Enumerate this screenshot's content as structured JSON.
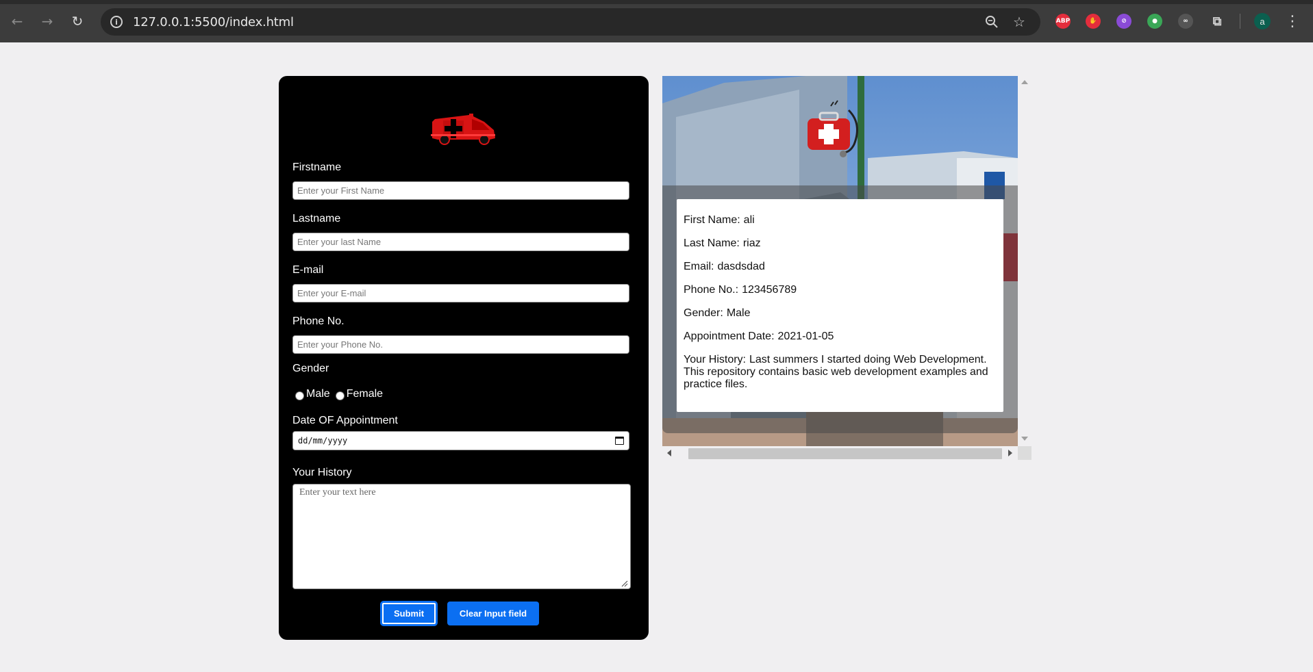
{
  "browser": {
    "url": "127.0.0.1:5500/index.html",
    "profile_initial": "a",
    "extensions": [
      {
        "name": "adblock-plus-icon",
        "label": "ABP",
        "color": "#e42d3c"
      },
      {
        "name": "stop-hand-icon",
        "label": "",
        "color": "#e42d3c"
      },
      {
        "name": "blocker-icon",
        "label": "",
        "color": "#8a4bd6"
      },
      {
        "name": "color-picker-icon",
        "label": "",
        "color": "#3aa757"
      },
      {
        "name": "link-extension-icon",
        "label": "",
        "color": "#2b2b2b"
      }
    ]
  },
  "form": {
    "firstname_label": "Firstname",
    "firstname_placeholder": "Enter your First Name",
    "lastname_label": "Lastname",
    "lastname_placeholder": "Enter your last Name",
    "email_label": "E-mail",
    "email_placeholder": "Enter your E-mail",
    "phone_label": "Phone No.",
    "phone_placeholder": "Enter your Phone No.",
    "gender_label": "Gender",
    "gender_options": [
      "Male",
      "Female"
    ],
    "date_label": "Date OF Appointment",
    "date_placeholder": "dd/mm/yyyy",
    "history_label": "Your History",
    "history_placeholder": "Enter your text here",
    "submit_label": "Submit",
    "clear_label": "Clear Input field"
  },
  "details": {
    "first_name_label": "First Name:",
    "first_name_value": "ali",
    "last_name_label": "Last Name:",
    "last_name_value": "riaz",
    "email_label": "Email:",
    "email_value": "dasdsdad",
    "phone_label": "Phone No.:",
    "phone_value": "123456789",
    "gender_label": "Gender:",
    "gender_value": "Male",
    "date_label": "Appointment Date:",
    "date_value": "2021-01-05",
    "history_label": "Your History:",
    "history_value": "Last summers I started doing Web Development. This repository contains basic web development examples and practice files."
  },
  "colors": {
    "accent": "#0b6ff2",
    "card_bg": "#000000",
    "page_bg": "#f0eff1"
  }
}
